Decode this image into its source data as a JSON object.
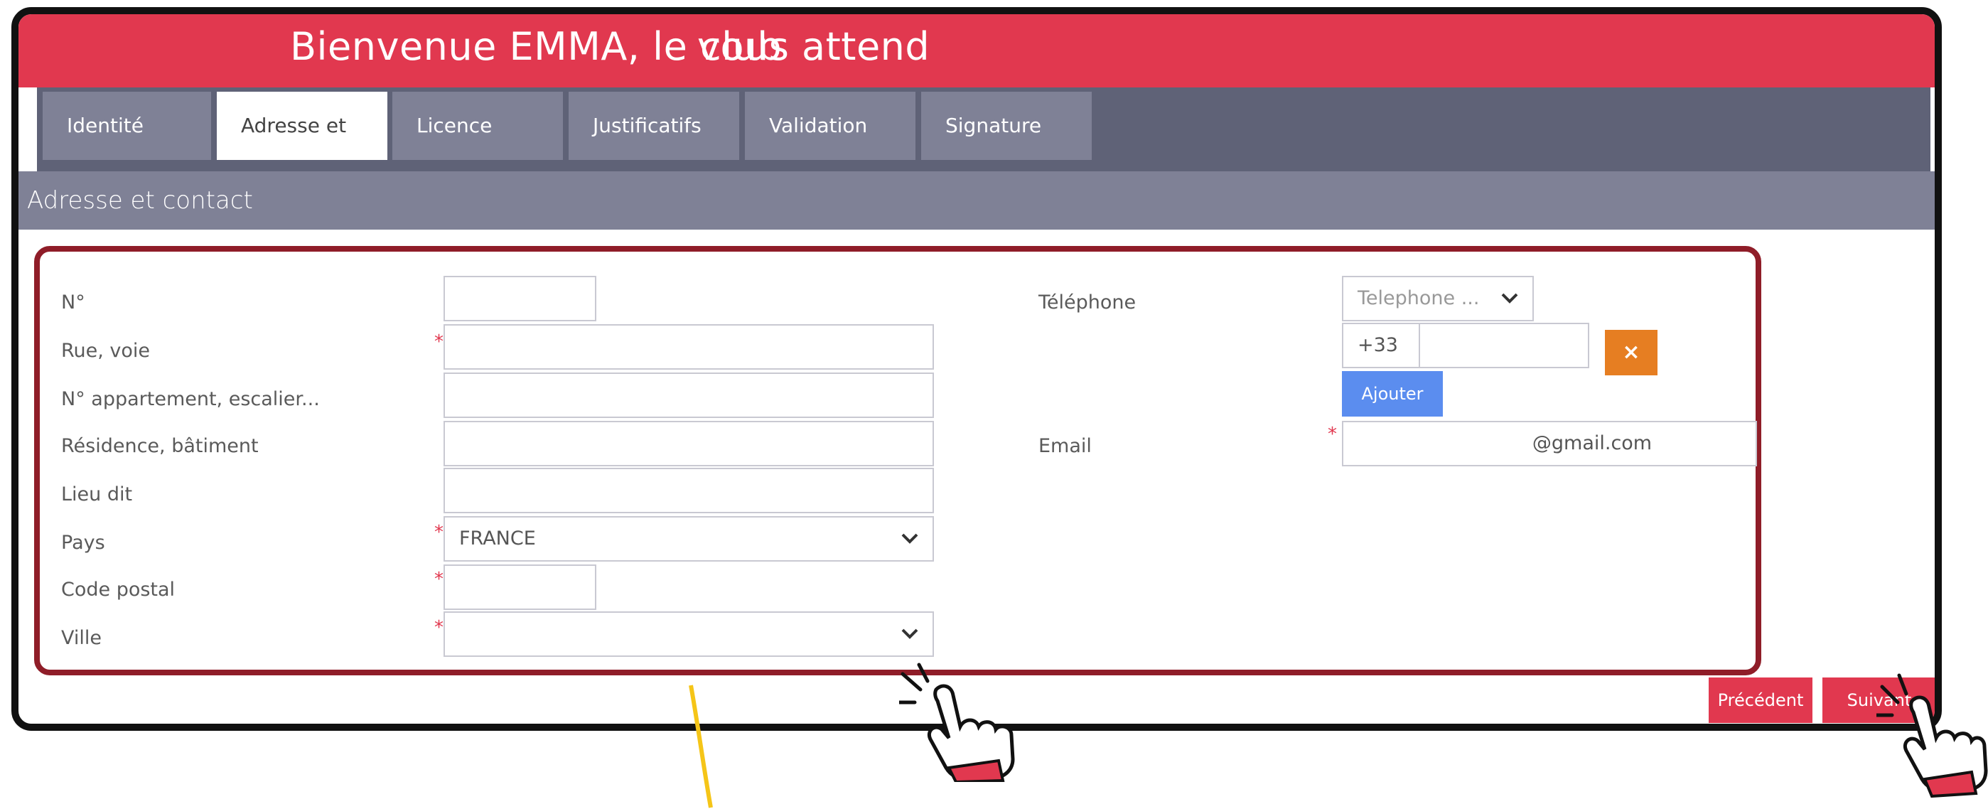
{
  "header": {
    "title_left": "Bienvenue EMMA, le club",
    "title_right": "vous attend"
  },
  "tabs": [
    {
      "label": "Identité"
    },
    {
      "label": "Adresse et contact"
    },
    {
      "label": "Licence"
    },
    {
      "label": "Justificatifs"
    },
    {
      "label": "Validation"
    },
    {
      "label": "Signature"
    }
  ],
  "section": {
    "title": "Adresse et contact"
  },
  "address": {
    "numero": {
      "label": "N°",
      "value": ""
    },
    "rue": {
      "label": "Rue, voie",
      "value": ""
    },
    "appartement": {
      "label": "N° appartement, escalier...",
      "value": ""
    },
    "residence": {
      "label": "Résidence, bâtiment",
      "value": ""
    },
    "lieu_dit": {
      "label": "Lieu dit",
      "value": ""
    },
    "pays": {
      "label": "Pays",
      "value": "FRANCE"
    },
    "code_postal": {
      "label": "Code postal",
      "value": ""
    },
    "ville": {
      "label": "Ville",
      "value": ""
    }
  },
  "contact": {
    "telephone_label": "Téléphone",
    "telephone_type_placeholder": "Telephone ...",
    "country_code": "+33",
    "phone_value": "",
    "remove_symbol": "×",
    "add_label": "Ajouter",
    "email_label": "Email",
    "email_value": "@gmail.com"
  },
  "required_mark": "*",
  "nav": {
    "previous_label": "Précédent",
    "next_label": "Suivant"
  },
  "colors": {
    "brand_red": "#e1384f",
    "tab_gray": "#7f8196",
    "frame_dark_red": "#8f1d28",
    "add_blue": "#5b8def",
    "remove_orange": "#e67e22",
    "annotation_yellow": "#f5c518"
  },
  "icons": [
    "chevron-down-icon",
    "close-icon",
    "pointer-hand-icon"
  ]
}
